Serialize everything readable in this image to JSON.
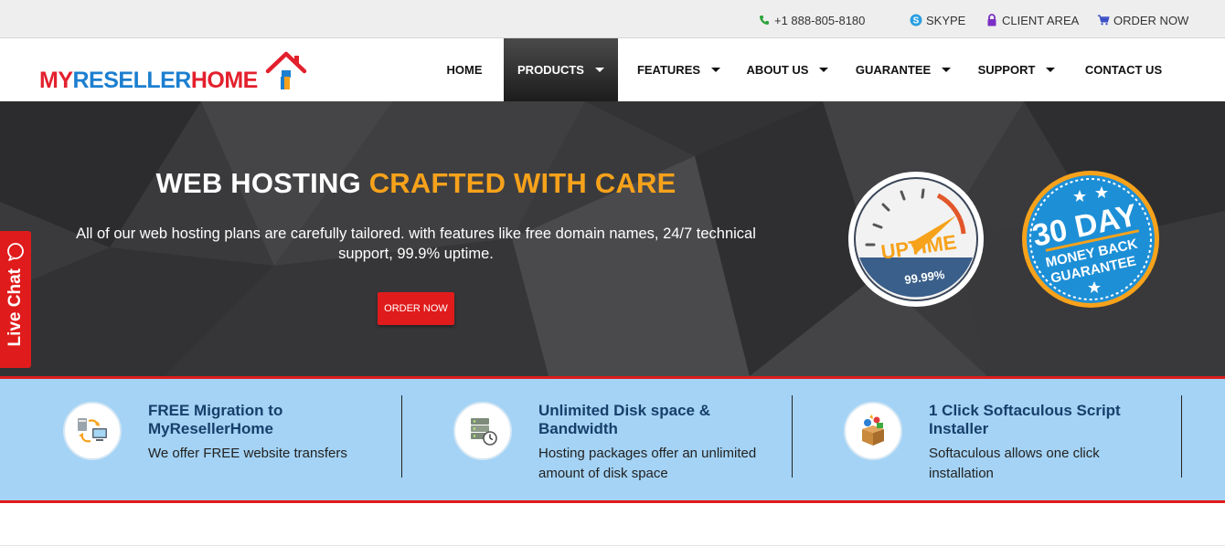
{
  "topbar": {
    "phone": "+1 888-805-8180",
    "skype": "SKYPE",
    "client_area": "CLIENT AREA",
    "order_now": "ORDER NOW"
  },
  "logo": {
    "part1": "MY",
    "part2": "RESELLER",
    "part3": "HOME"
  },
  "nav": {
    "items": [
      {
        "label": "HOME",
        "has_dropdown": false,
        "active": false
      },
      {
        "label": "PRODUCTS",
        "has_dropdown": true,
        "active": true
      },
      {
        "label": "FEATURES",
        "has_dropdown": true,
        "active": false
      },
      {
        "label": "ABOUT US",
        "has_dropdown": true,
        "active": false
      },
      {
        "label": "GUARANTEE",
        "has_dropdown": true,
        "active": false
      },
      {
        "label": "SUPPORT",
        "has_dropdown": true,
        "active": false
      },
      {
        "label": "CONTACT US",
        "has_dropdown": false,
        "active": false
      }
    ]
  },
  "hero": {
    "title_white": "WEB HOSTING ",
    "title_accent": "CRAFTED WITH CARE",
    "subtitle": "All of our web hosting plans are carefully tailored. with features like free domain names, 24/7 technical support, 99.9% uptime.",
    "button": "ORDER NOW",
    "uptime_badge": {
      "label": "UPTIME",
      "value": "99.99%"
    },
    "money_badge": {
      "line1": "30 DAY",
      "line2": "MONEY BACK",
      "line3": "GUARANTEE"
    }
  },
  "livechat": {
    "label": "Live Chat"
  },
  "features": [
    {
      "title": "FREE Migration to MyResellerHome",
      "desc": "We offer FREE website transfers"
    },
    {
      "title": "Unlimited Disk space & Bandwidth",
      "desc": "Hosting packages offer an unlimited amount of disk space"
    },
    {
      "title": "1 Click Softaculous Script Installer",
      "desc": "Softaculous allows one click installation"
    }
  ],
  "colors": {
    "brand_red": "#e01b1b",
    "brand_blue": "#1c7fd0",
    "accent_orange": "#f7a21b",
    "strip_blue": "#a4d3f5",
    "title_navy": "#173f6b"
  }
}
